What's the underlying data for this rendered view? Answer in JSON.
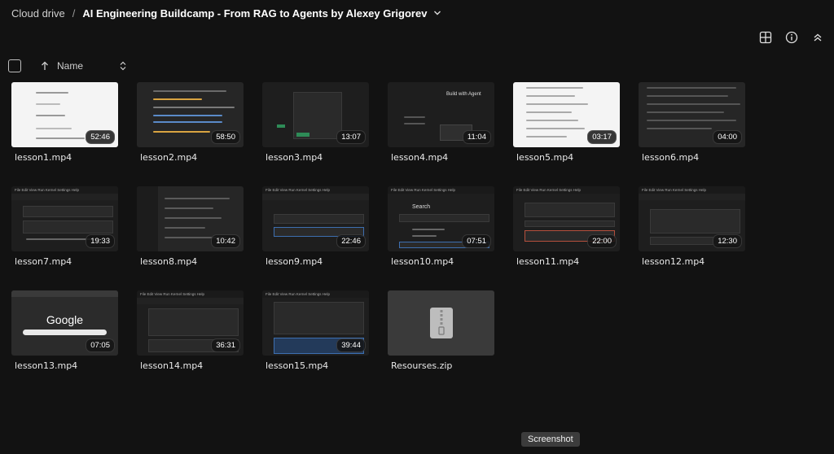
{
  "breadcrumb": {
    "root": "Cloud drive",
    "separator": "/",
    "current": "AI Engineering Buildcamp - From RAG to Agents by Alexey Grigorev"
  },
  "toolbar": {
    "icons": [
      "grid-view-icon",
      "info-icon",
      "collapse-icon"
    ]
  },
  "sort": {
    "label": "Name"
  },
  "files": [
    {
      "name": "lesson1.mp4",
      "duration": "52:46"
    },
    {
      "name": "lesson2.mp4",
      "duration": "58:50"
    },
    {
      "name": "lesson3.mp4",
      "duration": "13:07"
    },
    {
      "name": "lesson4.mp4",
      "duration": "11:04"
    },
    {
      "name": "lesson5.mp4",
      "duration": "03:17"
    },
    {
      "name": "lesson6.mp4",
      "duration": "04:00"
    },
    {
      "name": "lesson7.mp4",
      "duration": "19:33"
    },
    {
      "name": "lesson8.mp4",
      "duration": "10:42"
    },
    {
      "name": "lesson9.mp4",
      "duration": "22:46"
    },
    {
      "name": "lesson10.mp4",
      "duration": "07:51"
    },
    {
      "name": "lesson11.mp4",
      "duration": "22:00"
    },
    {
      "name": "lesson12.mp4",
      "duration": "12:30"
    },
    {
      "name": "lesson13.mp4",
      "duration": "07:05"
    },
    {
      "name": "lesson14.mp4",
      "duration": "36:31"
    },
    {
      "name": "lesson15.mp4",
      "duration": "39:44"
    },
    {
      "name": "Resourses.zip",
      "duration": ""
    }
  ],
  "thumbs": {
    "google_logo": "Google",
    "build_with_agent": "Build with Agent",
    "search": "Search",
    "jupyter_menu": "File  Edit  View  Run  Kernel  Settings  Help"
  },
  "tooltip": "Screenshot"
}
